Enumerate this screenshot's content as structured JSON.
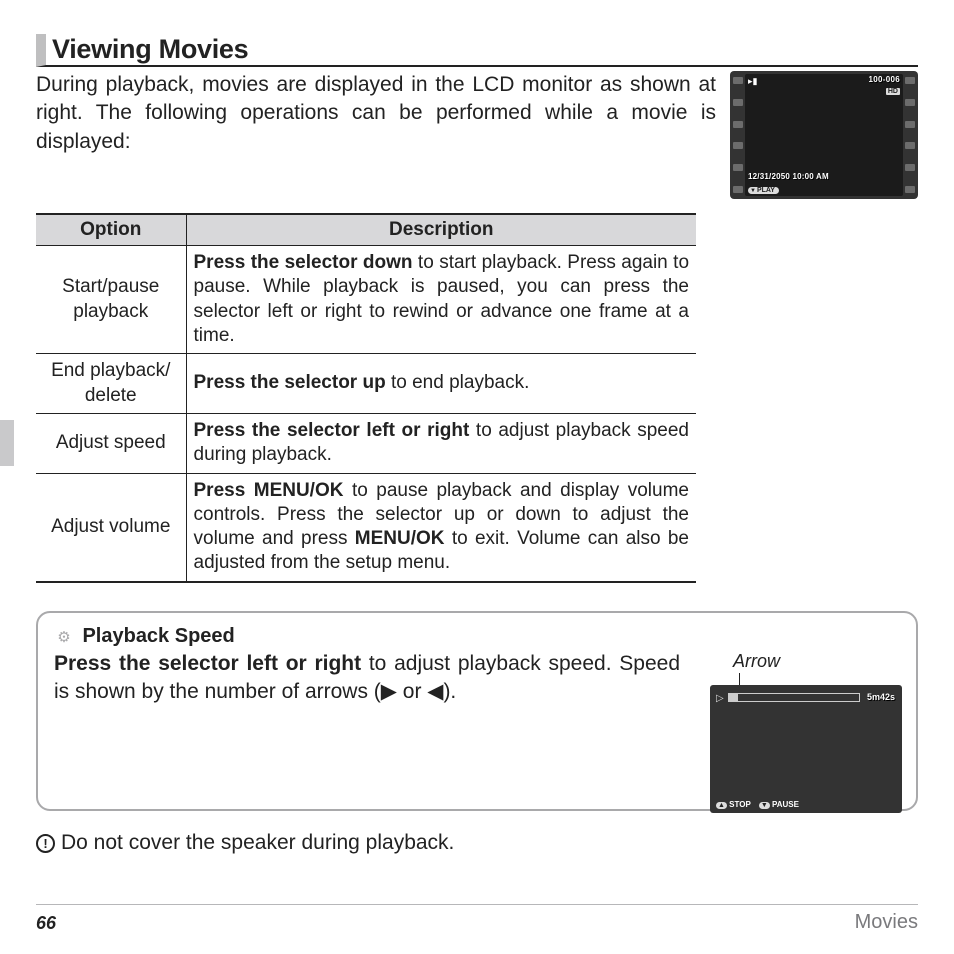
{
  "heading": "Viewing Movies",
  "intro": "During playback, movies are displayed in the LCD monitor as shown at right. The following operations can be performed while a movie is displayed:",
  "lcd1": {
    "file_index": "100-006",
    "hd_badge": "HD",
    "datetime": "12/31/2050   10:00 AM",
    "play_label": "PLAY"
  },
  "table": {
    "headers": {
      "option": "Option",
      "description": "Description"
    },
    "rows": [
      {
        "option": "Start/pause playback",
        "bold": "Press the selector down",
        "rest": " to start playback. Press again to pause. While playback is paused, you can press the selector left or right to rewind or advance one frame at a time."
      },
      {
        "option": "End playback/ delete",
        "bold": "Press the selector up",
        "rest": " to end playback."
      },
      {
        "option": "Adjust speed",
        "bold": "Press the selector left or right",
        "rest": " to adjust playback speed during playback."
      },
      {
        "option": "Adjust volume",
        "bold": "Press MENU/OK",
        "rest_a": " to pause playback and display volume controls. Press the selector up or down to adjust the volume and press ",
        "bold2": "MENU/OK",
        "rest_b": " to exit. Volume can also be adjusted from the setup menu."
      }
    ]
  },
  "tip": {
    "title": "Playback Speed",
    "bold_lead": "Press the selector left or right",
    "body": " to adjust playback speed. Speed is shown by the number of arrows (▶ or ◀).",
    "arrow_label": "Arrow",
    "lcd2": {
      "remaining": "5m42s",
      "stop": "STOP",
      "pause": "PAUSE"
    }
  },
  "caution": "Do not cover the speaker during playback.",
  "footer": {
    "page": "66",
    "section": "Movies"
  }
}
